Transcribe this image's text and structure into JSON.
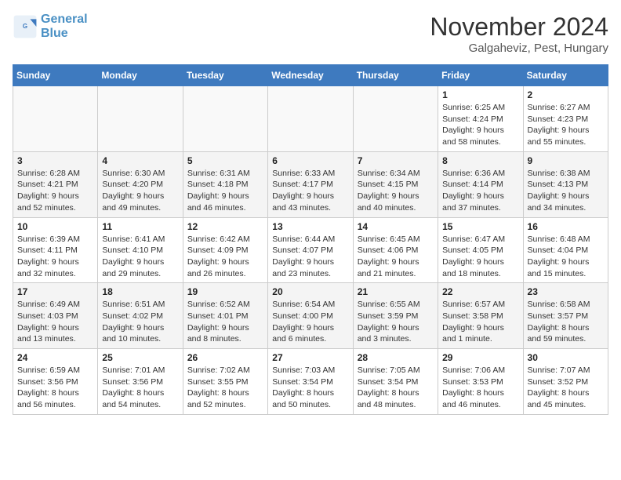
{
  "logo": {
    "line1": "General",
    "line2": "Blue"
  },
  "title": "November 2024",
  "location": "Galgaheviz, Pest, Hungary",
  "weekdays": [
    "Sunday",
    "Monday",
    "Tuesday",
    "Wednesday",
    "Thursday",
    "Friday",
    "Saturday"
  ],
  "weeks": [
    [
      {
        "day": "",
        "info": ""
      },
      {
        "day": "",
        "info": ""
      },
      {
        "day": "",
        "info": ""
      },
      {
        "day": "",
        "info": ""
      },
      {
        "day": "",
        "info": ""
      },
      {
        "day": "1",
        "info": "Sunrise: 6:25 AM\nSunset: 4:24 PM\nDaylight: 9 hours and 58 minutes."
      },
      {
        "day": "2",
        "info": "Sunrise: 6:27 AM\nSunset: 4:23 PM\nDaylight: 9 hours and 55 minutes."
      }
    ],
    [
      {
        "day": "3",
        "info": "Sunrise: 6:28 AM\nSunset: 4:21 PM\nDaylight: 9 hours and 52 minutes."
      },
      {
        "day": "4",
        "info": "Sunrise: 6:30 AM\nSunset: 4:20 PM\nDaylight: 9 hours and 49 minutes."
      },
      {
        "day": "5",
        "info": "Sunrise: 6:31 AM\nSunset: 4:18 PM\nDaylight: 9 hours and 46 minutes."
      },
      {
        "day": "6",
        "info": "Sunrise: 6:33 AM\nSunset: 4:17 PM\nDaylight: 9 hours and 43 minutes."
      },
      {
        "day": "7",
        "info": "Sunrise: 6:34 AM\nSunset: 4:15 PM\nDaylight: 9 hours and 40 minutes."
      },
      {
        "day": "8",
        "info": "Sunrise: 6:36 AM\nSunset: 4:14 PM\nDaylight: 9 hours and 37 minutes."
      },
      {
        "day": "9",
        "info": "Sunrise: 6:38 AM\nSunset: 4:13 PM\nDaylight: 9 hours and 34 minutes."
      }
    ],
    [
      {
        "day": "10",
        "info": "Sunrise: 6:39 AM\nSunset: 4:11 PM\nDaylight: 9 hours and 32 minutes."
      },
      {
        "day": "11",
        "info": "Sunrise: 6:41 AM\nSunset: 4:10 PM\nDaylight: 9 hours and 29 minutes."
      },
      {
        "day": "12",
        "info": "Sunrise: 6:42 AM\nSunset: 4:09 PM\nDaylight: 9 hours and 26 minutes."
      },
      {
        "day": "13",
        "info": "Sunrise: 6:44 AM\nSunset: 4:07 PM\nDaylight: 9 hours and 23 minutes."
      },
      {
        "day": "14",
        "info": "Sunrise: 6:45 AM\nSunset: 4:06 PM\nDaylight: 9 hours and 21 minutes."
      },
      {
        "day": "15",
        "info": "Sunrise: 6:47 AM\nSunset: 4:05 PM\nDaylight: 9 hours and 18 minutes."
      },
      {
        "day": "16",
        "info": "Sunrise: 6:48 AM\nSunset: 4:04 PM\nDaylight: 9 hours and 15 minutes."
      }
    ],
    [
      {
        "day": "17",
        "info": "Sunrise: 6:49 AM\nSunset: 4:03 PM\nDaylight: 9 hours and 13 minutes."
      },
      {
        "day": "18",
        "info": "Sunrise: 6:51 AM\nSunset: 4:02 PM\nDaylight: 9 hours and 10 minutes."
      },
      {
        "day": "19",
        "info": "Sunrise: 6:52 AM\nSunset: 4:01 PM\nDaylight: 9 hours and 8 minutes."
      },
      {
        "day": "20",
        "info": "Sunrise: 6:54 AM\nSunset: 4:00 PM\nDaylight: 9 hours and 6 minutes."
      },
      {
        "day": "21",
        "info": "Sunrise: 6:55 AM\nSunset: 3:59 PM\nDaylight: 9 hours and 3 minutes."
      },
      {
        "day": "22",
        "info": "Sunrise: 6:57 AM\nSunset: 3:58 PM\nDaylight: 9 hours and 1 minute."
      },
      {
        "day": "23",
        "info": "Sunrise: 6:58 AM\nSunset: 3:57 PM\nDaylight: 8 hours and 59 minutes."
      }
    ],
    [
      {
        "day": "24",
        "info": "Sunrise: 6:59 AM\nSunset: 3:56 PM\nDaylight: 8 hours and 56 minutes."
      },
      {
        "day": "25",
        "info": "Sunrise: 7:01 AM\nSunset: 3:56 PM\nDaylight: 8 hours and 54 minutes."
      },
      {
        "day": "26",
        "info": "Sunrise: 7:02 AM\nSunset: 3:55 PM\nDaylight: 8 hours and 52 minutes."
      },
      {
        "day": "27",
        "info": "Sunrise: 7:03 AM\nSunset: 3:54 PM\nDaylight: 8 hours and 50 minutes."
      },
      {
        "day": "28",
        "info": "Sunrise: 7:05 AM\nSunset: 3:54 PM\nDaylight: 8 hours and 48 minutes."
      },
      {
        "day": "29",
        "info": "Sunrise: 7:06 AM\nSunset: 3:53 PM\nDaylight: 8 hours and 46 minutes."
      },
      {
        "day": "30",
        "info": "Sunrise: 7:07 AM\nSunset: 3:52 PM\nDaylight: 8 hours and 45 minutes."
      }
    ]
  ]
}
